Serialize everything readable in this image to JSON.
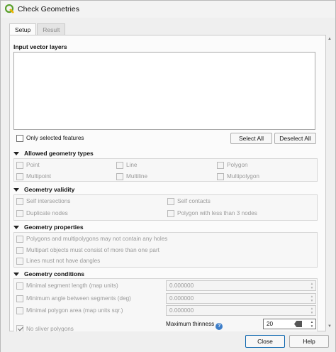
{
  "window": {
    "title": "Check Geometries"
  },
  "tabs": [
    {
      "label": "Setup",
      "active": true
    },
    {
      "label": "Result",
      "active": false
    }
  ],
  "input_layers": {
    "title": "Input vector layers",
    "only_selected_label": "Only selected features",
    "select_all_label": "Select All",
    "deselect_all_label": "Deselect All"
  },
  "allowed_types": {
    "title": "Allowed geometry types",
    "items": [
      "Point",
      "Line",
      "Polygon",
      "Multipoint",
      "Multiline",
      "Multipolygon"
    ]
  },
  "validity": {
    "title": "Geometry validity",
    "items": [
      "Self intersections",
      "Self contacts",
      "Duplicate nodes",
      "Polygon with less than 3 nodes"
    ]
  },
  "properties": {
    "title": "Geometry properties",
    "items": [
      "Polygons and multipolygons may not contain any holes",
      "Multipart objects must consist of more than one part",
      "Lines must not have dangles"
    ]
  },
  "conditions": {
    "title": "Geometry conditions",
    "items": [
      {
        "label": "Minimal segment length (map units)",
        "value": "0.000000"
      },
      {
        "label": "Minimum angle between segments (deg)",
        "value": "0.000000"
      },
      {
        "label": "Minimal polygon area (map units sqr.)",
        "value": "0.000000"
      }
    ],
    "sliver_label": "No sliver polygons",
    "sliver_checked": true,
    "max_thinness_label": "Maximum thinness",
    "max_thinness_value": "20"
  },
  "footer": {
    "close_label": "Close",
    "help_label": "Help"
  },
  "colors": {
    "accent": "#0a64ad",
    "qgis_green": "#5aa02c",
    "help_blue": "#3d7ec9"
  }
}
